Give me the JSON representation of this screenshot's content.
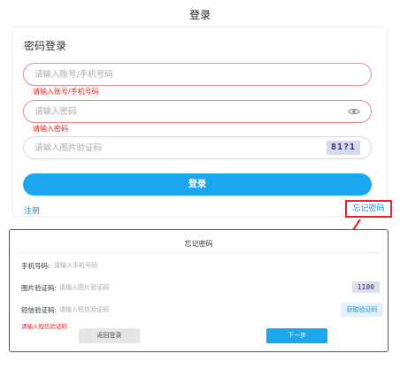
{
  "page": {
    "title": "登录"
  },
  "login": {
    "card_title": "密码登录",
    "account": {
      "placeholder": "请输入账号/手机号码",
      "error": "请输入账号/手机号码"
    },
    "password": {
      "placeholder": "请输入密码",
      "error": "请输入密码",
      "icon": "eye-icon"
    },
    "captcha": {
      "placeholder": "请输入图片验证码",
      "image_text": "81?1"
    },
    "login_button": "登录",
    "register_link": "注册",
    "forgot_link": "忘记密码"
  },
  "forgot": {
    "title": "忘记密码",
    "phone": {
      "label": "手机号码:",
      "placeholder": "请输入手机号码"
    },
    "image_code": {
      "label": "图片验证码:",
      "placeholder": "请输入图片验证码",
      "image_text": "1100"
    },
    "sms_code": {
      "label": "短信验证码:",
      "placeholder": "请输入短信验证码",
      "button": "获取验证码",
      "error": "请输入短信验证码"
    },
    "back_button": "返回登录",
    "next_button": "下一步"
  },
  "colors": {
    "accent": "#1aa7ee",
    "error": "#e02020",
    "highlight_box": "#e5262d"
  }
}
